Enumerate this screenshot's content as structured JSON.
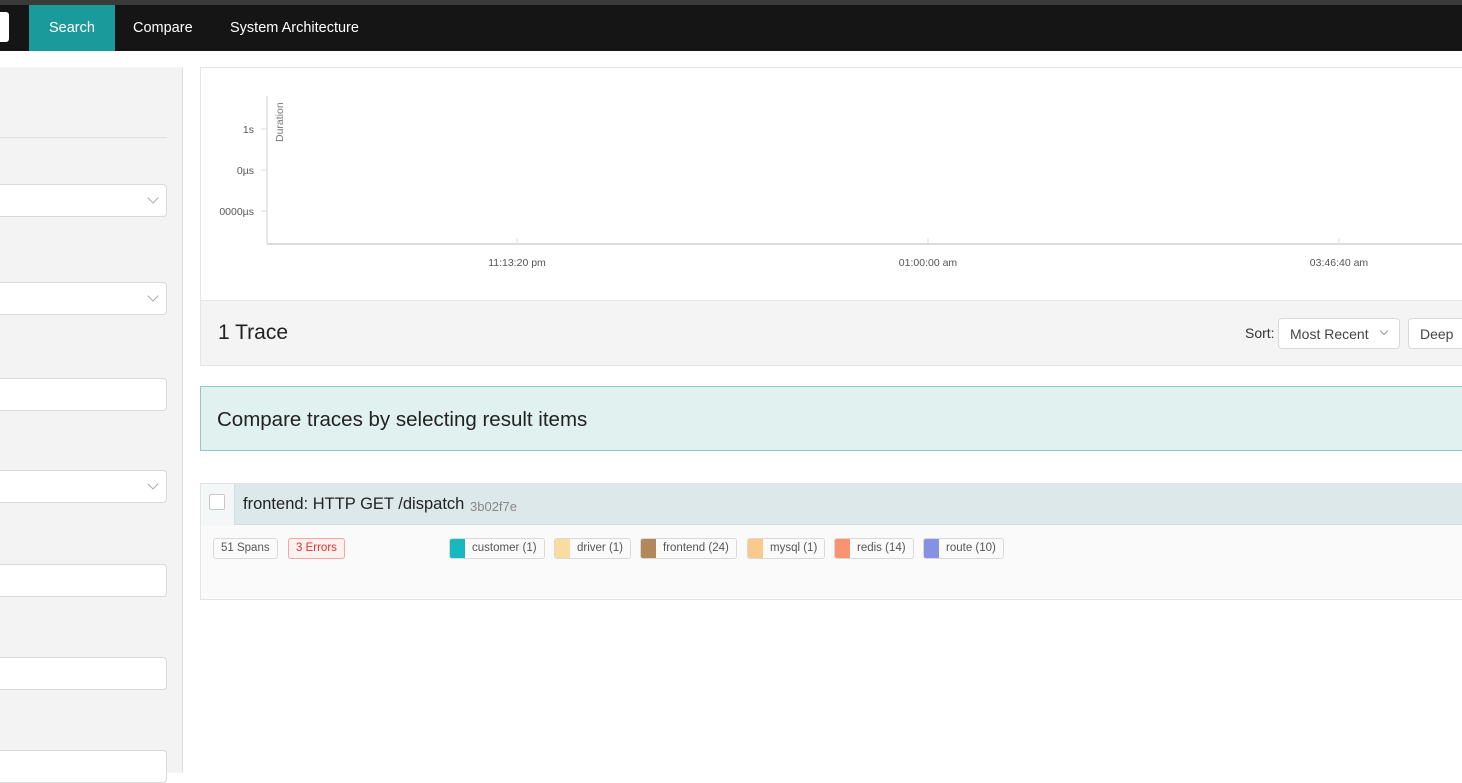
{
  "nav": {
    "tabs": [
      {
        "label": "Search",
        "active": true
      },
      {
        "label": "Compare",
        "active": false
      },
      {
        "label": "System Architecture",
        "active": false
      }
    ],
    "accent": "#1a9a9a"
  },
  "chart_data": {
    "type": "scatter",
    "ylabel": "Duration",
    "y_ticks": [
      "1s",
      "0µs",
      "0000µs"
    ],
    "x_ticks": [
      "11:13:20 pm",
      "01:00:00 am",
      "03:46:40 am"
    ],
    "series": []
  },
  "results": {
    "count_label": "1 Trace",
    "sort_label": "Sort:",
    "sort_value": "Most Recent",
    "deep_label": "Deep"
  },
  "compare_banner": "Compare traces by selecting result items",
  "trace": {
    "title": "frontend: HTTP GET /dispatch",
    "id": "3b02f7e",
    "spans": "51 Spans",
    "errors": "3 Errors",
    "services": [
      {
        "label": "customer (1)",
        "color": "#17b8be"
      },
      {
        "label": "driver (1)",
        "color": "#f8dca0"
      },
      {
        "label": "frontend (24)",
        "color": "#b1885a"
      },
      {
        "label": "mysql (1)",
        "color": "#fac98e"
      },
      {
        "label": "redis (14)",
        "color": "#f89570"
      },
      {
        "label": "route (10)",
        "color": "#8592e3"
      }
    ]
  }
}
